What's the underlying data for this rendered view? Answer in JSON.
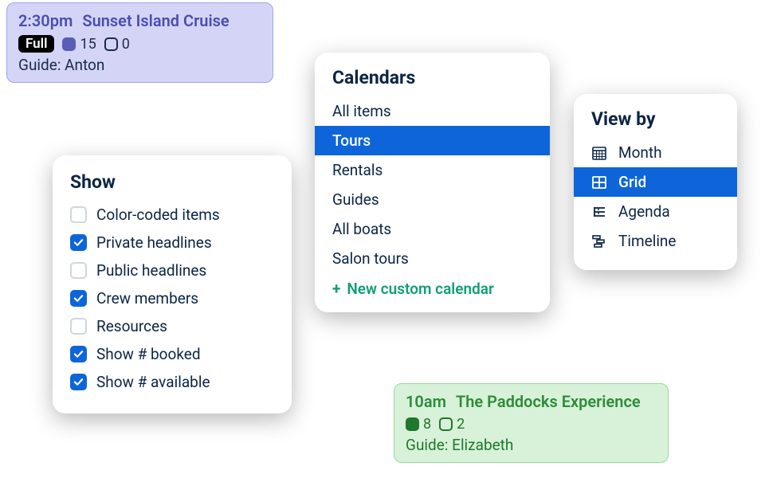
{
  "events": {
    "purple": {
      "time": "2:30pm",
      "title": "Sunset Island Cruise",
      "status_label": "Full",
      "booked_count": "15",
      "available_count": "0",
      "guide_text": "Guide: Anton"
    },
    "green": {
      "time": "10am",
      "title": "The Paddocks Experience",
      "booked_count": "8",
      "available_count": "2",
      "guide_text": "Guide: Elizabeth"
    }
  },
  "panels": {
    "show": {
      "title": "Show",
      "items": [
        {
          "label": "Color-coded items",
          "checked": false
        },
        {
          "label": "Private headlines",
          "checked": true
        },
        {
          "label": "Public headlines",
          "checked": false
        },
        {
          "label": "Crew members",
          "checked": true
        },
        {
          "label": "Resources",
          "checked": false
        },
        {
          "label": "Show # booked",
          "checked": true
        },
        {
          "label": "Show # available",
          "checked": true
        }
      ]
    },
    "calendars": {
      "title": "Calendars",
      "items": [
        {
          "label": "All items",
          "selected": false
        },
        {
          "label": "Tours",
          "selected": true
        },
        {
          "label": "Rentals",
          "selected": false
        },
        {
          "label": "Guides",
          "selected": false
        },
        {
          "label": "All boats",
          "selected": false
        },
        {
          "label": "Salon tours",
          "selected": false
        }
      ],
      "new_label": "New custom calendar"
    },
    "viewby": {
      "title": "View by",
      "items": [
        {
          "label": "Month",
          "icon": "calendar",
          "selected": false
        },
        {
          "label": "Grid",
          "icon": "grid",
          "selected": true
        },
        {
          "label": "Agenda",
          "icon": "agenda",
          "selected": false
        },
        {
          "label": "Timeline",
          "icon": "timeline",
          "selected": false
        }
      ]
    }
  }
}
